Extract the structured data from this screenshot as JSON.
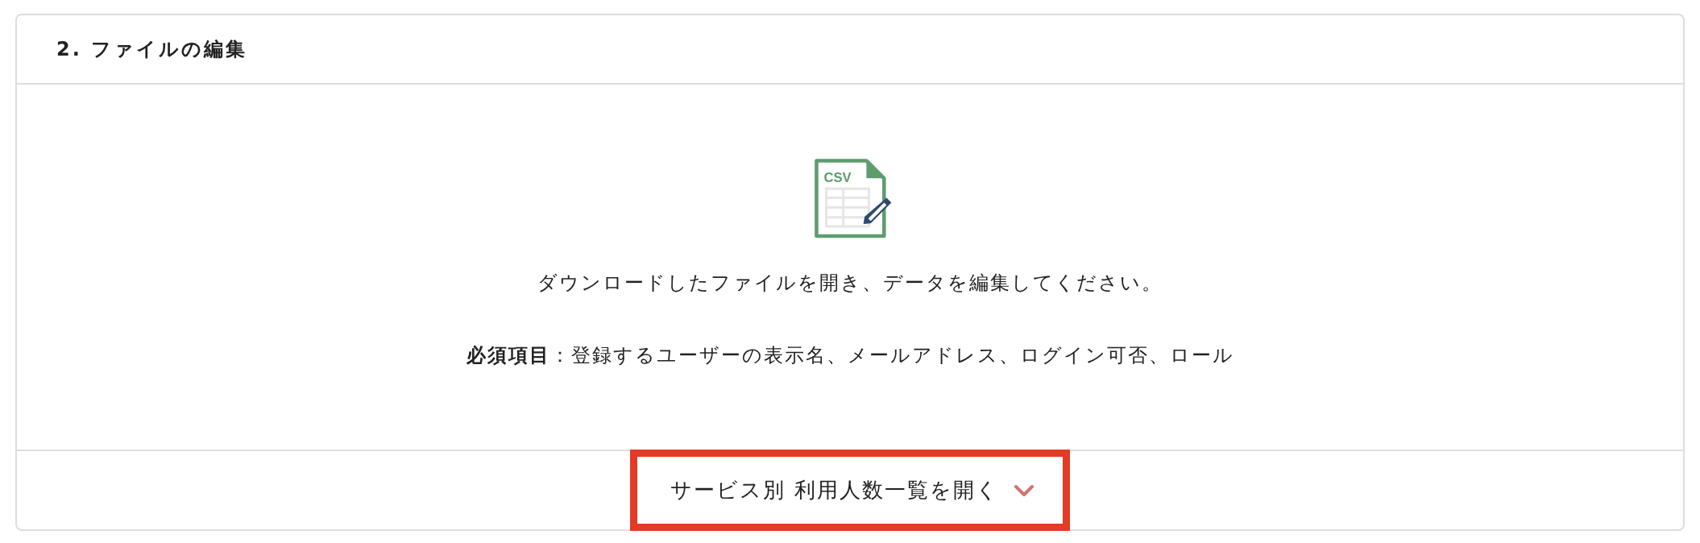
{
  "section": {
    "title": "2. ファイルの編集"
  },
  "icon": {
    "label": "CSV"
  },
  "instructions": [
    "ダウンロードしたファイルを開き、データを編集してください。",
    "**必須項目**：登録するユーザーの表示名、メールアドレス、ログイン可否、ロール"
  ],
  "toggle": {
    "label": "サービス別 利用人数一覧を開く",
    "expanded": false,
    "highlighted": true
  }
}
